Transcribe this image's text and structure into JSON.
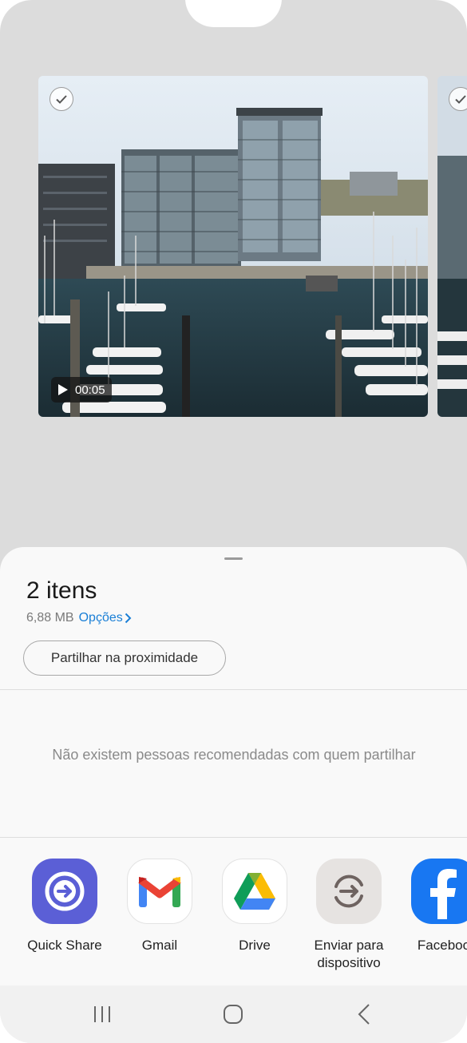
{
  "preview": {
    "duration": "00:05",
    "icons": {
      "check": "check-icon",
      "play": "play-icon"
    }
  },
  "sheet": {
    "title": "2 itens",
    "size": "6,88 MB",
    "options_label": "Opções",
    "nearby_share_label": "Partilhar na proximidade",
    "empty_message": "Não existem pessoas recomendadas com quem partilhar"
  },
  "apps": [
    {
      "label": "Quick Share",
      "icon": "quick-share-icon"
    },
    {
      "label": "Gmail",
      "icon": "gmail-icon"
    },
    {
      "label": "Drive",
      "icon": "drive-icon"
    },
    {
      "label": "Enviar para dispositivo",
      "icon": "send-to-device-icon"
    },
    {
      "label": "Faceboo",
      "icon": "facebook-icon"
    }
  ],
  "navbar": {
    "icons": [
      "recent-apps-icon",
      "home-icon",
      "back-icon"
    ]
  },
  "colors": {
    "accent": "#1a7fd6",
    "quick_share": "#5b5fd6",
    "facebook": "#1877f2"
  }
}
